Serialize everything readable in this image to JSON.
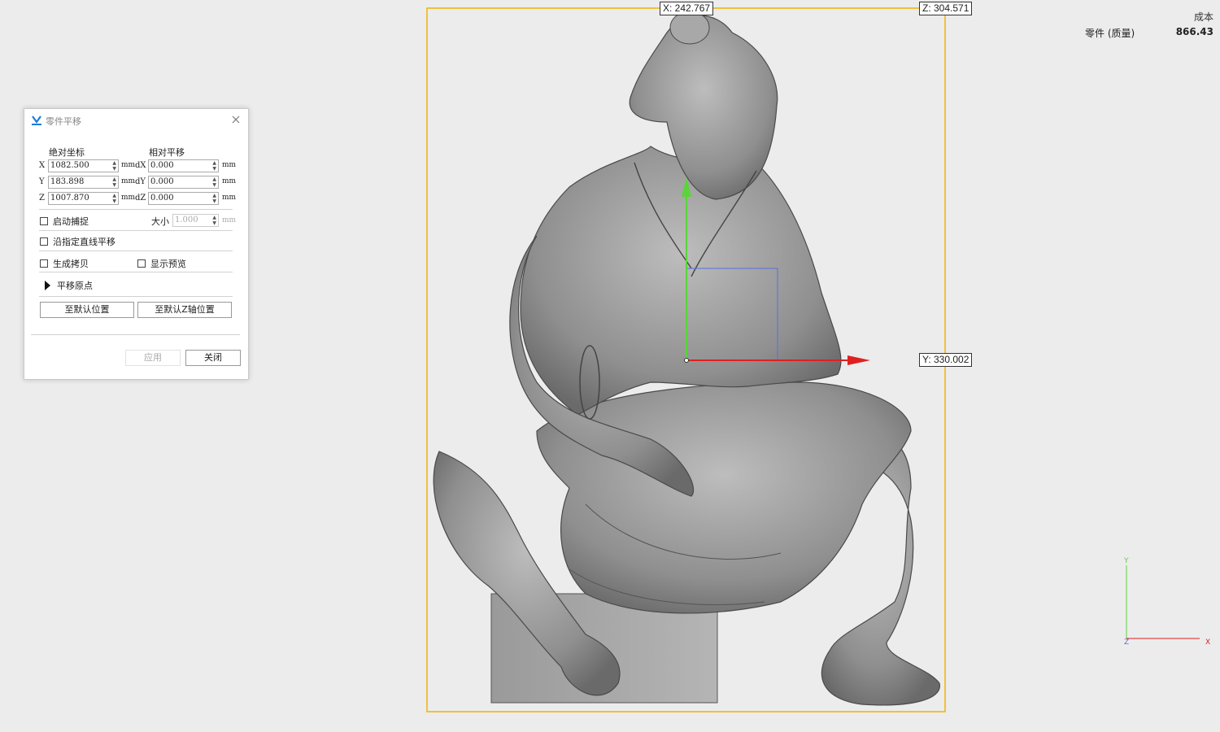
{
  "cost": {
    "title": "成本",
    "label": "零件 (质量)",
    "value": "866.43"
  },
  "viewport": {
    "bbox_x_label": "X: 242.767",
    "bbox_z_label": "Z: 304.571",
    "bbox_y_label": "Y: 330.002",
    "bbox_color": "#f0b400",
    "axis_triad": {
      "y": "Y",
      "x": "X",
      "z": "Z"
    },
    "gizmo_x_color": "#e02020",
    "gizmo_y_color": "#5ad43a",
    "gizmo_plane_color": "#5a6ee0"
  },
  "dialog": {
    "title": "零件平移",
    "absolute_heading": "绝对坐标",
    "relative_heading": "相对平移",
    "rows": [
      {
        "axis": "X",
        "value": "1082.500",
        "unit": "mm",
        "dlabel": "dX",
        "dvalue": "0.000",
        "dunit": "mm"
      },
      {
        "axis": "Y",
        "value": "183.898",
        "unit": "mm",
        "dlabel": "dY",
        "dvalue": "0.000",
        "dunit": "mm"
      },
      {
        "axis": "Z",
        "value": "1007.870",
        "unit": "mm",
        "dlabel": "dZ",
        "dvalue": "0.000",
        "dunit": "mm"
      }
    ],
    "snap_label": "启动捕捉",
    "size_label": "大小",
    "size_value": "1.000",
    "size_unit": "mm",
    "line_move_label": "沿指定直线平移",
    "copy_label": "生成拷贝",
    "preview_label": "显示预览",
    "origin_label": "平移原点",
    "btn_default_pos": "至默认位置",
    "btn_default_z": "至默认Z轴位置",
    "btn_apply": "应用",
    "btn_close": "关闭"
  }
}
